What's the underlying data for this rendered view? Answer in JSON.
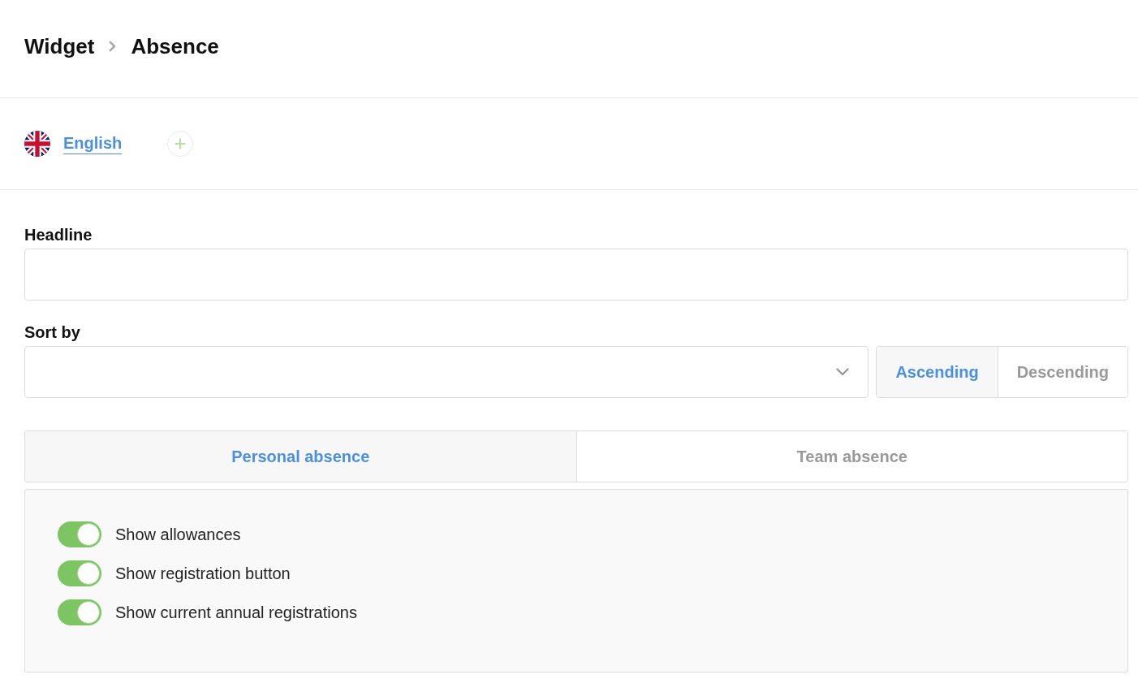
{
  "breadcrumb": [
    {
      "label": "Widget"
    },
    {
      "label": "Absence"
    }
  ],
  "languages": [
    {
      "label": "English",
      "selected": true
    }
  ],
  "headline": {
    "label": "Headline"
  },
  "sort": {
    "label": "Sort by",
    "order": [
      {
        "label": "Ascending",
        "selected": true
      },
      {
        "label": "Descending",
        "selected": false
      }
    ]
  },
  "tabs": [
    {
      "label": "Personal absence",
      "selected": true
    },
    {
      "label": "Team absence",
      "selected": false
    }
  ],
  "options": [
    {
      "label": "Show allowances",
      "on": true
    },
    {
      "label": "Show registration button",
      "on": true
    },
    {
      "label": "Show current annual registrations",
      "on": true
    }
  ]
}
